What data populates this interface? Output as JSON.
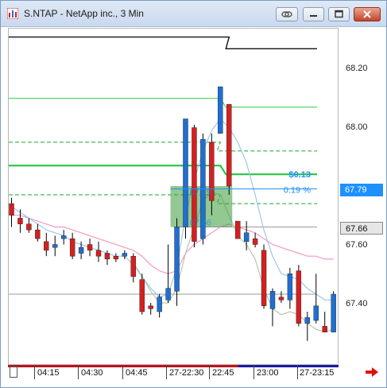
{
  "window": {
    "title": "S.NTAP - NetApp inc., 3 Min",
    "buttons": [
      "link",
      "minimize",
      "maximize",
      "close"
    ]
  },
  "colors": {
    "up": "#1f6fd1",
    "down": "#d42020",
    "accent": "#1e90ff",
    "green_line": "#2ecc40",
    "pink_ma": "#f29ac6",
    "blue_ma": "#9cc8ea",
    "grey_ma": "#b9c6b0"
  },
  "price_axis": {
    "ticks": [
      "68.20",
      "68.00",
      "67.80",
      "67.60",
      "67.40"
    ],
    "current_price_label": "67.79",
    "last_price_label": "67.66"
  },
  "time_axis": {
    "labels": [
      "04:15",
      "04:30",
      "04:45",
      "27-22:30",
      "22:45",
      "23:00",
      "27-23:15"
    ]
  },
  "position_overlay": {
    "pnl_label": "$0.13",
    "pct_label": "0.19 %",
    "entry_price_text": "67.79",
    "stop_price_text": "67.66"
  },
  "chart_data": {
    "type": "candlestick",
    "ylim": [
      67.26,
      68.33
    ],
    "y_ticks": [
      68.2,
      68.0,
      67.8,
      67.6,
      67.4
    ],
    "x_labels": [
      "04:15",
      "04:30",
      "04:45",
      "27-22:30",
      "22:45",
      "23:00",
      "27-23:15"
    ],
    "candles": [
      {
        "o": 67.74,
        "h": 67.76,
        "l": 67.66,
        "c": 67.7
      },
      {
        "o": 67.69,
        "h": 67.72,
        "l": 67.64,
        "c": 67.67
      },
      {
        "o": 67.67,
        "h": 67.69,
        "l": 67.64,
        "c": 67.65
      },
      {
        "o": 67.65,
        "h": 67.67,
        "l": 67.61,
        "c": 67.62
      },
      {
        "o": 67.61,
        "h": 67.64,
        "l": 67.56,
        "c": 67.58
      },
      {
        "o": 67.59,
        "h": 67.63,
        "l": 67.56,
        "c": 67.6
      },
      {
        "o": 67.62,
        "h": 67.65,
        "l": 67.6,
        "c": 67.63
      },
      {
        "o": 67.62,
        "h": 67.64,
        "l": 67.55,
        "c": 67.56
      },
      {
        "o": 67.57,
        "h": 67.61,
        "l": 67.55,
        "c": 67.59
      },
      {
        "o": 67.6,
        "h": 67.62,
        "l": 67.56,
        "c": 67.58
      },
      {
        "o": 67.58,
        "h": 67.61,
        "l": 67.54,
        "c": 67.56
      },
      {
        "o": 67.57,
        "h": 67.58,
        "l": 67.53,
        "c": 67.55
      },
      {
        "o": 67.56,
        "h": 67.57,
        "l": 67.54,
        "c": 67.55
      },
      {
        "o": 67.56,
        "h": 67.58,
        "l": 67.55,
        "c": 67.57
      },
      {
        "o": 67.56,
        "h": 67.57,
        "l": 67.47,
        "c": 67.49
      },
      {
        "o": 67.48,
        "h": 67.5,
        "l": 67.36,
        "c": 67.37
      },
      {
        "o": 67.39,
        "h": 67.4,
        "l": 67.36,
        "c": 67.38
      },
      {
        "o": 67.37,
        "h": 67.43,
        "l": 67.35,
        "c": 67.42
      },
      {
        "o": 67.41,
        "h": 67.6,
        "l": 67.4,
        "c": 67.45
      },
      {
        "o": 67.44,
        "h": 67.69,
        "l": 67.39,
        "c": 67.66
      },
      {
        "o": 67.66,
        "h": 68.03,
        "l": 67.62,
        "c": 68.03
      },
      {
        "o": 68.0,
        "h": 68.01,
        "l": 67.59,
        "c": 67.61
      },
      {
        "o": 67.62,
        "h": 67.98,
        "l": 67.6,
        "c": 67.96
      },
      {
        "o": 67.95,
        "h": 67.98,
        "l": 67.7,
        "c": 67.75
      },
      {
        "o": 67.98,
        "h": 68.14,
        "l": 67.98,
        "c": 68.14
      },
      {
        "o": 68.08,
        "h": 68.08,
        "l": 67.77,
        "c": 67.8
      },
      {
        "o": 67.68,
        "h": 67.68,
        "l": 67.62,
        "c": 67.62
      },
      {
        "o": 67.61,
        "h": 67.68,
        "l": 67.58,
        "c": 67.64
      },
      {
        "o": 67.62,
        "h": 67.64,
        "l": 67.59,
        "c": 67.6
      },
      {
        "o": 67.58,
        "h": 67.6,
        "l": 67.38,
        "c": 67.39
      },
      {
        "o": 67.38,
        "h": 67.45,
        "l": 67.32,
        "c": 67.44
      },
      {
        "o": 67.42,
        "h": 67.44,
        "l": 67.4,
        "c": 67.41
      },
      {
        "o": 67.41,
        "h": 67.52,
        "l": 67.38,
        "c": 67.5
      },
      {
        "o": 67.51,
        "h": 67.53,
        "l": 67.32,
        "c": 67.33
      },
      {
        "o": 67.33,
        "h": 67.37,
        "l": 67.27,
        "c": 67.35
      },
      {
        "o": 67.34,
        "h": 67.5,
        "l": 67.33,
        "c": 67.39
      },
      {
        "o": 67.32,
        "h": 67.37,
        "l": 67.3,
        "c": 67.3
      },
      {
        "o": 67.3,
        "h": 67.44,
        "l": 67.3,
        "c": 67.43
      }
    ],
    "horizontal_lines": [
      {
        "name": "black-level",
        "segments": [
          [
            0,
            25,
            68.31
          ],
          [
            25,
            38,
            68.27
          ]
        ]
      },
      {
        "name": "green-solid-upper",
        "segments": [
          [
            0,
            24,
            68.1
          ],
          [
            25,
            38,
            68.07
          ]
        ]
      },
      {
        "name": "green-dashed-upper",
        "segments": [
          [
            0,
            24,
            67.95
          ],
          [
            24,
            38,
            67.92
          ]
        ]
      },
      {
        "name": "green-solid-main",
        "segments": [
          [
            0,
            24,
            67.87
          ],
          [
            25,
            38,
            67.84
          ]
        ]
      },
      {
        "name": "green-dashed-lower",
        "segments": [
          [
            0,
            24,
            67.77
          ],
          [
            24,
            38,
            67.74
          ]
        ]
      },
      {
        "name": "grey-last",
        "segments": [
          [
            19,
            38,
            67.66
          ]
        ]
      },
      {
        "name": "grey-low",
        "segments": [
          [
            0,
            38,
            67.43
          ]
        ]
      }
    ],
    "moving_averages": {
      "pink": [
        67.7,
        67.7,
        67.69,
        67.68,
        67.67,
        67.66,
        67.66,
        67.65,
        67.64,
        67.63,
        67.62,
        67.61,
        67.6,
        67.59,
        67.58,
        67.56,
        67.53,
        67.51,
        67.5,
        67.51,
        67.57,
        67.6,
        67.62,
        67.64,
        67.66,
        67.67,
        67.66,
        67.65,
        67.64,
        67.62,
        67.6,
        67.59,
        67.58,
        67.57,
        67.56,
        67.56,
        67.55,
        67.55
      ],
      "blue": [
        67.73,
        67.71,
        67.69,
        67.67,
        67.65,
        67.64,
        67.63,
        67.61,
        67.6,
        67.59,
        67.58,
        67.57,
        67.56,
        67.56,
        67.53,
        67.49,
        67.45,
        67.42,
        67.43,
        67.52,
        67.7,
        67.82,
        67.92,
        67.99,
        68.03,
        68.0,
        67.95,
        67.88,
        67.77,
        67.65,
        67.56,
        67.5,
        67.49,
        67.48,
        67.45,
        67.43,
        67.41,
        67.41
      ],
      "grey": [
        null,
        null,
        null,
        null,
        null,
        null,
        null,
        null,
        null,
        null,
        null,
        null,
        null,
        null,
        67.54,
        67.49,
        67.44,
        67.4,
        67.4,
        67.45,
        67.57,
        67.66,
        67.75,
        67.78,
        67.77,
        67.7,
        67.63,
        67.6,
        67.55,
        67.45,
        67.38,
        67.36,
        67.37,
        67.36,
        67.33,
        67.31,
        67.3,
        67.31
      ]
    },
    "position_box": {
      "from_candle": 19,
      "to_candle": 25,
      "top": 67.8,
      "bottom": 67.66
    }
  }
}
